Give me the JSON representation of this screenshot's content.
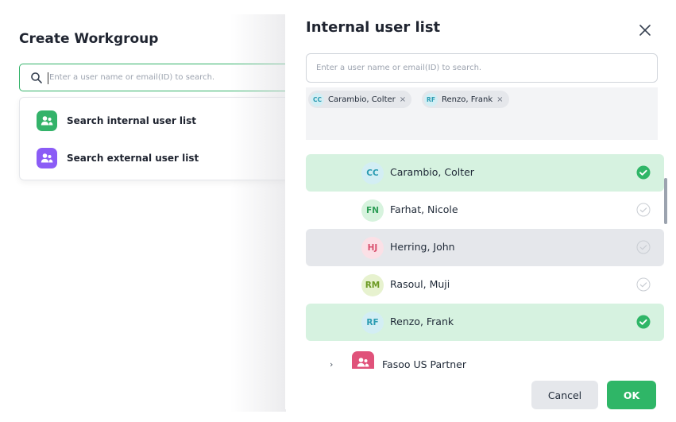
{
  "create_workgroup": {
    "title": "Create Workgroup",
    "search_placeholder": "Enter a user name or email(ID) to search.",
    "options": [
      {
        "label": "Search internal user list",
        "color": "#34b36a"
      },
      {
        "label": "Search external user list",
        "color": "#8b5cf6"
      }
    ]
  },
  "modal": {
    "title": "Internal user list",
    "search_placeholder": "Enter a user name or email(ID) to search.",
    "chips": [
      {
        "initials": "CC",
        "name": "Carambio, Colter"
      },
      {
        "initials": "RF",
        "name": "Renzo, Frank"
      }
    ],
    "users": [
      {
        "initials": "CC",
        "name": "Carambio, Colter",
        "selected": true,
        "avatar_bg": "#d3eef4",
        "avatar_fg": "#2a9bb2"
      },
      {
        "initials": "FN",
        "name": "Farhat, Nicole",
        "selected": false,
        "avatar_bg": "#d7f3de",
        "avatar_fg": "#2e9e57"
      },
      {
        "initials": "HJ",
        "name": "Herring, John",
        "selected": false,
        "avatar_bg": "#fbe0e6",
        "avatar_fg": "#d9506e"
      },
      {
        "initials": "RM",
        "name": "Rasoul, Muji",
        "selected": false,
        "avatar_bg": "#e7f2cf",
        "avatar_fg": "#6d9a24"
      },
      {
        "initials": "RF",
        "name": "Renzo, Frank",
        "selected": true,
        "avatar_bg": "#d3eef4",
        "avatar_fg": "#2a9bb2"
      }
    ],
    "group": {
      "label": "Fasoo US Partner",
      "color": "#e0527a"
    },
    "cancel_label": "Cancel",
    "ok_label": "OK"
  },
  "colors": {
    "accent": "#2fb667",
    "selected_row": "#d6f2e0",
    "hover_row": "#e5e7eb"
  },
  "icons": [
    "search-icon",
    "users-icon",
    "close-icon",
    "check-circle-icon",
    "chevron-right-icon"
  ]
}
